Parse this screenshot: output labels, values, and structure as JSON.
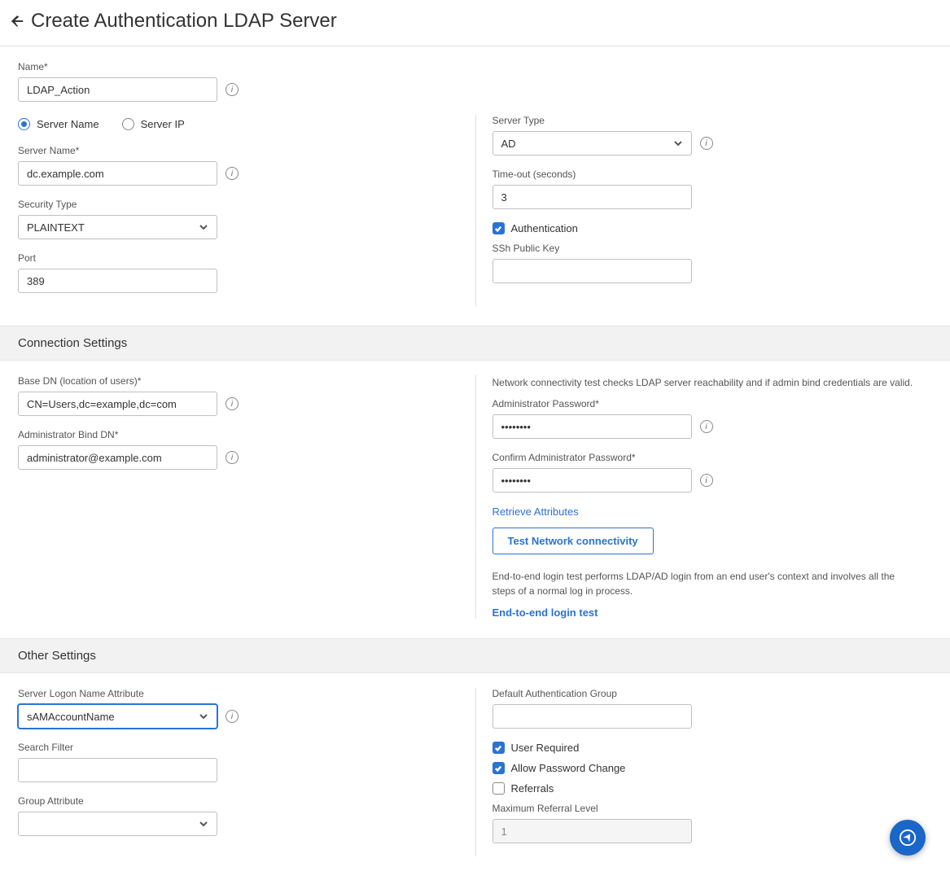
{
  "header": {
    "title": "Create Authentication LDAP Server"
  },
  "basic": {
    "name_label": "Name*",
    "name_value": "LDAP_Action",
    "radio_server_name": "Server Name",
    "radio_server_ip": "Server IP",
    "server_name_label": "Server Name*",
    "server_name_value": "dc.example.com",
    "security_type_label": "Security Type",
    "security_type_value": "PLAINTEXT",
    "port_label": "Port",
    "port_value": "389",
    "server_type_label": "Server Type",
    "server_type_value": "AD",
    "timeout_label": "Time-out (seconds)",
    "timeout_value": "3",
    "authentication_label": "Authentication",
    "ssh_public_key_label": "SSh Public Key",
    "ssh_public_key_value": ""
  },
  "connection": {
    "section_title": "Connection Settings",
    "base_dn_label": "Base DN (location of users)*",
    "base_dn_value": "CN=Users,dc=example,dc=com",
    "admin_bind_dn_label": "Administrator Bind DN*",
    "admin_bind_dn_value": "administrator@example.com",
    "net_help_text": "Network connectivity test checks LDAP server reachability and if admin bind credentials are valid.",
    "admin_password_label": "Administrator Password*",
    "admin_password_value": "••••••••",
    "confirm_admin_password_label": "Confirm Administrator Password*",
    "confirm_admin_password_value": "••••••••",
    "retrieve_attributes_link": "Retrieve Attributes",
    "test_network_button": "Test Network connectivity",
    "e2e_help_text": "End-to-end login test performs LDAP/AD login from an end user's context and involves all the steps of a normal log in process.",
    "e2e_link": "End-to-end login test"
  },
  "other": {
    "section_title": "Other Settings",
    "logon_attr_label": "Server Logon Name Attribute",
    "logon_attr_value": "sAMAccountName",
    "search_filter_label": "Search Filter",
    "search_filter_value": "",
    "group_attr_label": "Group Attribute",
    "group_attr_value": "",
    "default_auth_group_label": "Default Authentication Group",
    "default_auth_group_value": "",
    "user_required_label": "User Required",
    "allow_pw_change_label": "Allow Password Change",
    "referrals_label": "Referrals",
    "max_referral_label": "Maximum Referral Level",
    "max_referral_value": "1"
  }
}
